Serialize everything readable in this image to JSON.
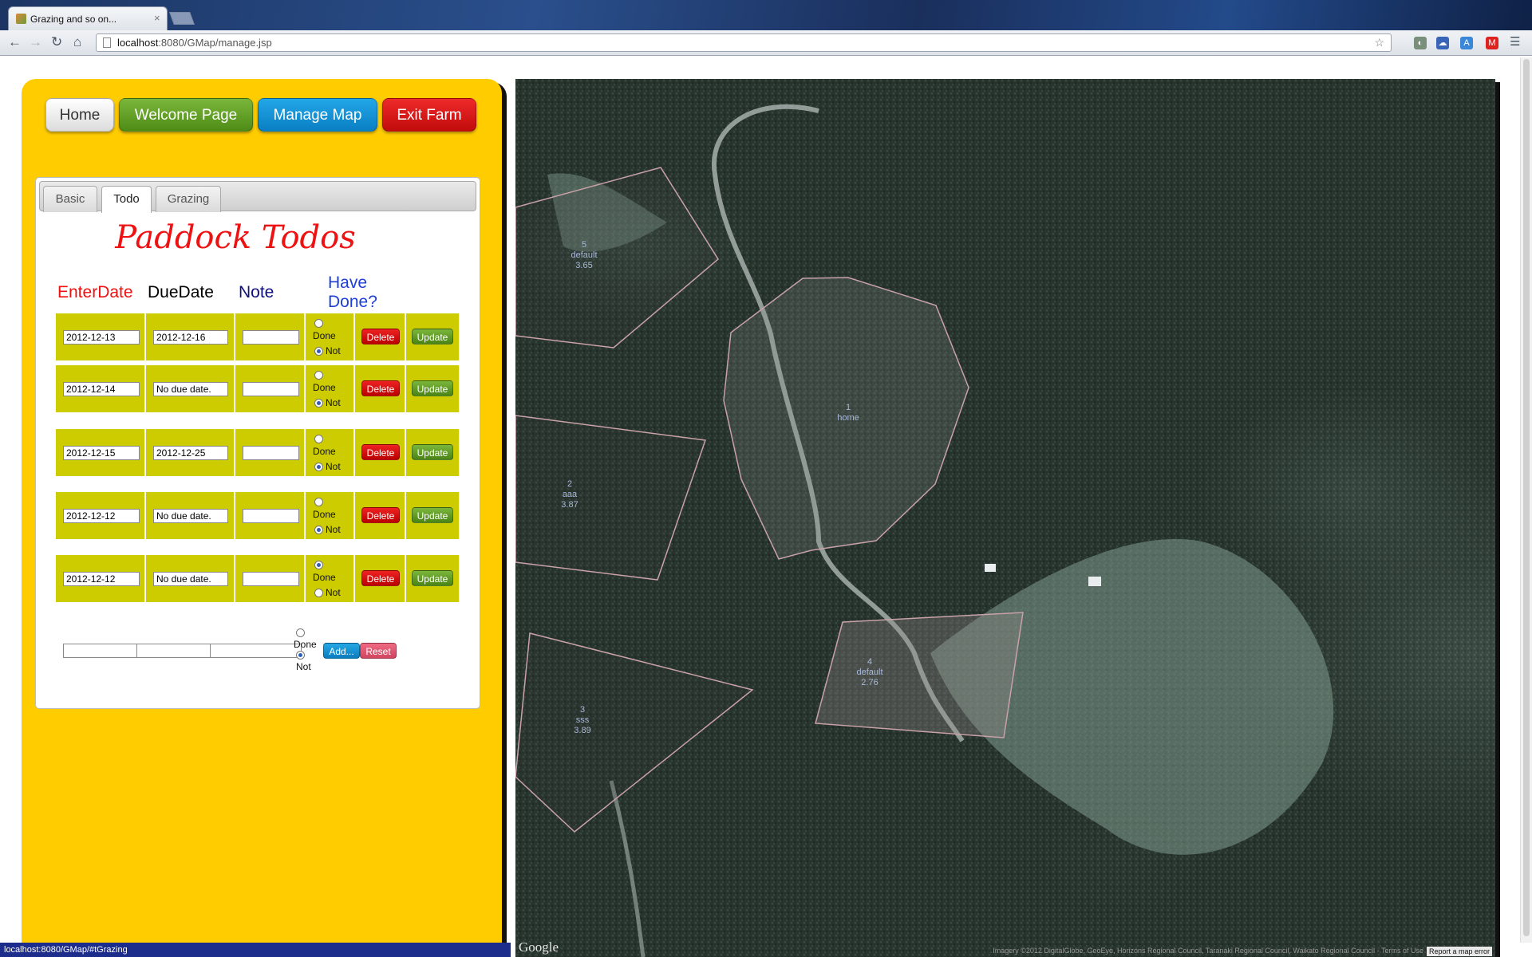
{
  "browser": {
    "tab_title": "Grazing and so on...",
    "tab_close": "×",
    "url_host": "localhost",
    "url_rest": ":8080/GMap/manage.jsp",
    "status_url": "localhost:8080/GMap/#tGrazing"
  },
  "nav": {
    "home": "Home",
    "welcome": "Welcome Page",
    "manage": "Manage Map",
    "exit": "Exit Farm"
  },
  "tabs": [
    "Basic",
    "Todo",
    "Grazing"
  ],
  "todo": {
    "title": "Paddock Todos",
    "headers": {
      "enter_date": "EnterDate",
      "due_date": "DueDate",
      "note": "Note",
      "have_done_1": "Have",
      "have_done_2": "Done?"
    },
    "done_label": "Done",
    "not_label": "Not",
    "delete_label": "Delete",
    "update_label": "Update",
    "add_label": "Add...",
    "reset_label": "Reset",
    "rows": [
      {
        "enter": "2012-12-13",
        "due": "2012-12-16",
        "note": "",
        "done": false
      },
      {
        "enter": "2012-12-14",
        "due": "No due date.",
        "note": "",
        "done": false
      },
      {
        "enter": "2012-12-15",
        "due": "2012-12-25",
        "note": "",
        "done": false
      },
      {
        "enter": "2012-12-12",
        "due": "No due date.",
        "note": "",
        "done": false
      },
      {
        "enter": "2012-12-12",
        "due": "No due date.",
        "note": "",
        "done": true
      }
    ]
  },
  "map": {
    "paddocks": [
      {
        "id": "5",
        "name": "default",
        "area": "3.65"
      },
      {
        "id": "1",
        "name": "home",
        "area": ""
      },
      {
        "id": "2",
        "name": "aaa",
        "area": "3.87"
      },
      {
        "id": "4",
        "name": "default",
        "area": "2.76"
      },
      {
        "id": "3",
        "name": "sss",
        "area": "3.89"
      }
    ],
    "google": "Google",
    "copyright": "Imagery ©2012 DigitalGlobe, GeoEye, Horizons Regional Council, Taranaki Regional Council, Waikato Regional Council - Terms of Use",
    "report": "Report a map error"
  },
  "colors": {
    "panel": "#ffcc00",
    "row_cell": "#cccc00",
    "title_red": "#ee1111"
  }
}
